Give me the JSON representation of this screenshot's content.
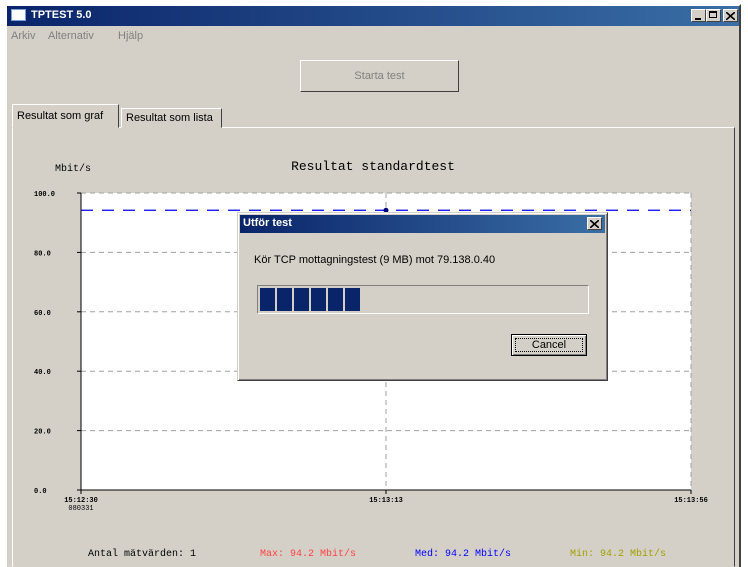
{
  "window": {
    "title": "TPTEST 5.0",
    "controls": [
      "minimize-icon",
      "maximize-icon",
      "close-icon"
    ]
  },
  "menu": {
    "items": [
      {
        "label": "Arkiv"
      },
      {
        "label": "Alternativ"
      },
      {
        "label": "Hjälp"
      }
    ]
  },
  "toolbar": {
    "start_label": "Starta test"
  },
  "tabs": [
    {
      "label": "Resultat som graf",
      "active": true
    },
    {
      "label": "Resultat som lista",
      "active": false
    }
  ],
  "chart_data": {
    "type": "line",
    "title": "Resultat standardtest",
    "ylabel": "Mbit/s",
    "xlabel": "",
    "ylim": [
      0,
      100
    ],
    "yticks": [
      0,
      20,
      40,
      60,
      80,
      100
    ],
    "ytick_labels": [
      "0.0",
      "20.0",
      "40.0",
      "60.0",
      "80.0",
      "100.0"
    ],
    "xtick_labels": [
      {
        "label": "15:12:30",
        "sub": "080331"
      },
      {
        "label": "15:13:13",
        "sub": ""
      },
      {
        "label": "15:13:56",
        "sub": ""
      }
    ],
    "grid": true,
    "series": [
      {
        "x": [
          "15:13:13"
        ],
        "values": [
          94.2
        ],
        "color": "#000080"
      }
    ],
    "reference_line": {
      "y": 94.2,
      "style": "dashed",
      "color": "#0000ff"
    }
  },
  "stats": {
    "count": "Antal mätvärden: 1",
    "max": "Max: 94.2 Mbit/s",
    "med": "Med: 94.2 Mbit/s",
    "min": "Min: 94.2 Mbit/s",
    "colors": {
      "count": "#000000",
      "max": "#ff4040",
      "med": "#0000ff",
      "min": "#a0a000"
    }
  },
  "dialog": {
    "title": "Utför test",
    "message": "Kör TCP mottagningstest (9 MB) mot 79.138.0.40",
    "progress": 0.34,
    "cancel_label": "Cancel"
  }
}
